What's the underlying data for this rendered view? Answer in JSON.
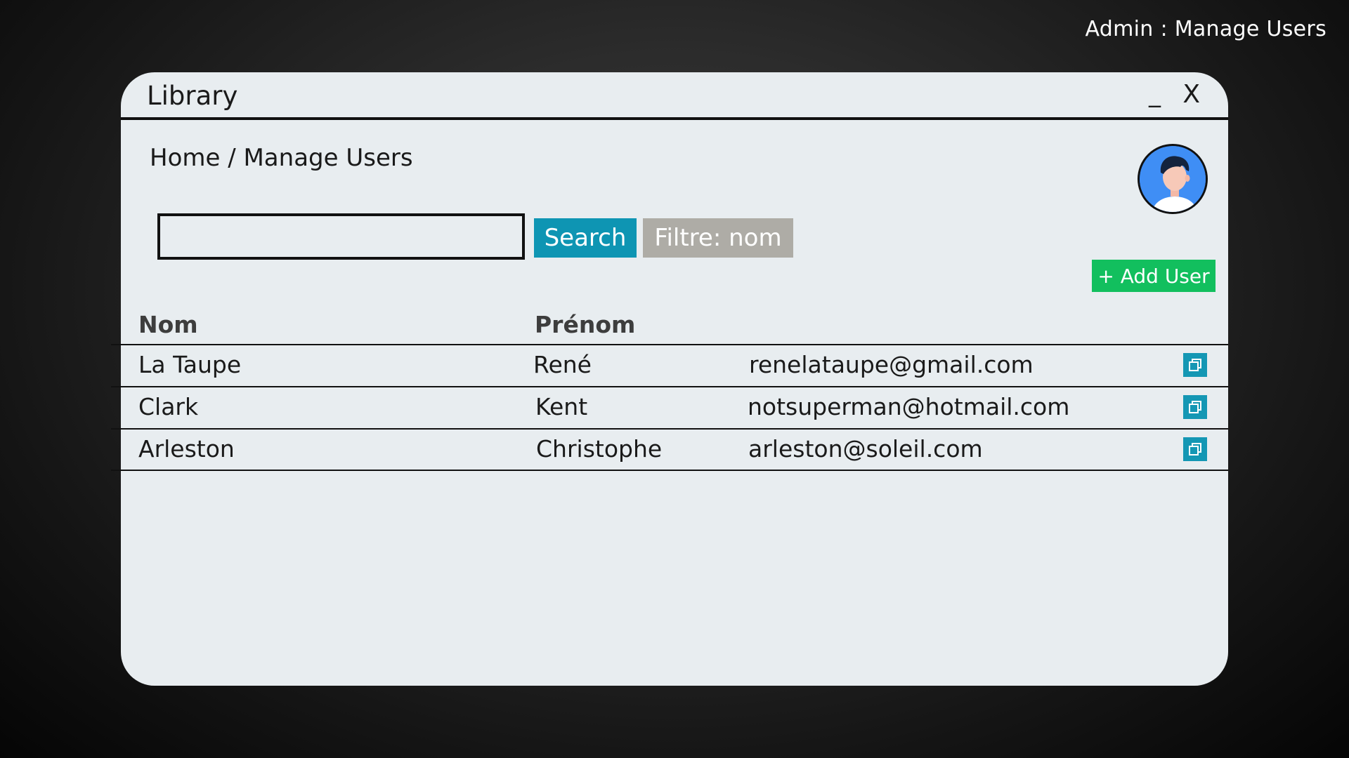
{
  "page": {
    "caption": "Admin : Manage Users"
  },
  "window": {
    "title": "Library",
    "minimize_label": "_",
    "close_label": "X"
  },
  "breadcrumb": "Home / Manage Users",
  "search": {
    "value": "",
    "placeholder": "",
    "button_label": "Search",
    "filter_label": "Filtre: nom"
  },
  "actions": {
    "add_user_label": "+ Add User"
  },
  "table": {
    "headers": [
      "Nom",
      "Prénom"
    ],
    "rows": [
      {
        "nom": "La Taupe",
        "prenom": "René",
        "email": "renelataupe@gmail.com",
        "action_icon": "copy-icon"
      },
      {
        "nom": "Clark",
        "prenom": "Kent",
        "email": "notsuperman@hotmail.com",
        "action_icon": "copy-icon"
      },
      {
        "nom": "Arleston",
        "prenom": "Christophe",
        "email": "arleston@soleil.com",
        "action_icon": "copy-icon"
      }
    ]
  },
  "colors": {
    "window_bg": "#e8edf0",
    "search_button": "#0e95b3",
    "filter_button": "#aeaca6",
    "add_button": "#12bf5e",
    "row_action": "#1497b4",
    "avatar_bg": "#3f8ef5"
  },
  "icons": {
    "avatar": "user-avatar-icon"
  }
}
